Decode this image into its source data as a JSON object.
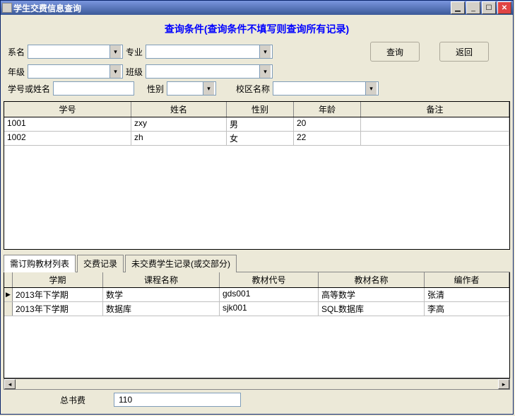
{
  "window": {
    "title": "学生交费信息查询"
  },
  "header": {
    "title": "查询条件(查询条件不填写则查询所有记录)"
  },
  "filters": {
    "dept_label": "系名",
    "major_label": "专业",
    "grade_label": "年级",
    "class_label": "班级",
    "idname_label": "学号或姓名",
    "gender_label": "性别",
    "campus_label": "校区名称",
    "query_btn": "查询",
    "back_btn": "返回"
  },
  "grid1": {
    "headers": [
      "学号",
      "姓名",
      "性别",
      "年龄",
      "备注"
    ],
    "rows": [
      {
        "c0": "1001",
        "c1": "zxy",
        "c2": "男",
        "c3": "20",
        "c4": ""
      },
      {
        "c0": "1002",
        "c1": "zh",
        "c2": "女",
        "c3": "22",
        "c4": ""
      }
    ]
  },
  "tabs": {
    "t0": "需订购教材列表",
    "t1": "交费记录",
    "t2": "未交费学生记录(或交部分)"
  },
  "grid2": {
    "headers": [
      "学期",
      "课程名称",
      "教材代号",
      "教材名称",
      "编作者"
    ],
    "rows": [
      {
        "mark": "▶",
        "c0": "2013年下学期",
        "c1": "数学",
        "c2": "gds001",
        "c3": "高等数学",
        "c4": "张清"
      },
      {
        "mark": "",
        "c0": "2013年下学期",
        "c1": "数据库",
        "c2": "sjk001",
        "c3": "SQL数据库",
        "c4": "李高"
      }
    ]
  },
  "footer": {
    "label": "总书费",
    "value": "110"
  }
}
